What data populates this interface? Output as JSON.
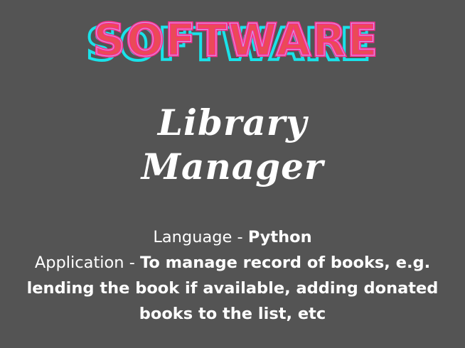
{
  "logo": {
    "text": "SOFTWARE",
    "colors": {
      "outline_cyan": "#19e3ea",
      "fill_pink": "#ff2b8f",
      "fill_red": "#ea4a57",
      "inner_lavender": "#c9a8e8"
    }
  },
  "title": {
    "line1": "Library",
    "line2": "Manager"
  },
  "details": {
    "language_label": "Language - ",
    "language_value": "Python",
    "application_label": "Application - ",
    "application_value_line1": "To manage record of books, e.g.",
    "application_value_line2": "lending the book if available, adding donated",
    "application_value_line3": "books to the list, etc"
  },
  "colors": {
    "background": "#545454",
    "text": "#ffffff"
  }
}
